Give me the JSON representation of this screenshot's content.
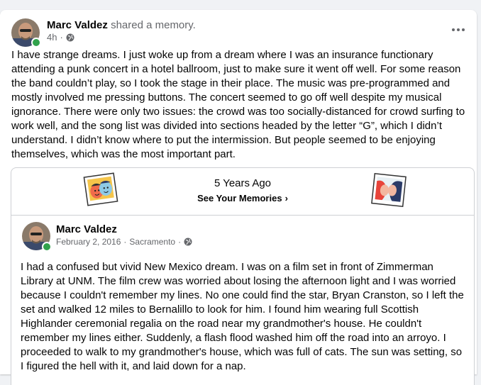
{
  "post": {
    "author": "Marc Valdez",
    "action": "shared a memory.",
    "time": "4h",
    "dot": "·",
    "privacy_icon": "globe-icon",
    "more_icon": "more-options-icon",
    "text": "I have strange dreams. I just woke up from a dream where I was an insurance functionary attending a punk concert in a hotel ballroom, just to make sure it went off well. For some reason the band couldn’t play, so I took the stage in their place. The music was pre-programmed and mostly involved me pressing buttons.  The concert seemed to go off well despite my musical ignorance. There were only two issues: the crowd was too socially-distanced for crowd surfing to work well, and the song list was divided into sections headed by the letter “G”, which I didn’t understand. I didn’t know where to put the intermission. But people seemed to be enjoying themselves, which was the most important part."
  },
  "memory": {
    "years_ago": "5 Years Ago",
    "see_memories": "See Your Memories",
    "chevron": "›",
    "shared": {
      "author": "Marc Valdez",
      "date": "February 2, 2016",
      "dot1": "·",
      "location": "Sacramento",
      "dot2": "·",
      "text": "I had a confused but vivid New Mexico dream.  I was on a film set in front of Zimmerman Library at UNM. The film crew was worried about losing the afternoon light and I was worried because I couldn't remember my lines. No one could find the star, Bryan Cranston, so I left the set and walked 12 miles to Bernalillo to look for him. I found him wearing full Scottish Highlander ceremonial regalia on the road near my grandmother's house. He couldn't remember my lines either. Suddenly, a flash flood washed him off the road into an arroyo. I proceeded to walk to my grandmother's house, which was full of cats. The sun was setting, so I figured the hell with it, and laid down for a nap."
    }
  },
  "colors": {
    "online": "#31a24c",
    "secondary_text": "#65676b",
    "border": "#ced0d4"
  }
}
